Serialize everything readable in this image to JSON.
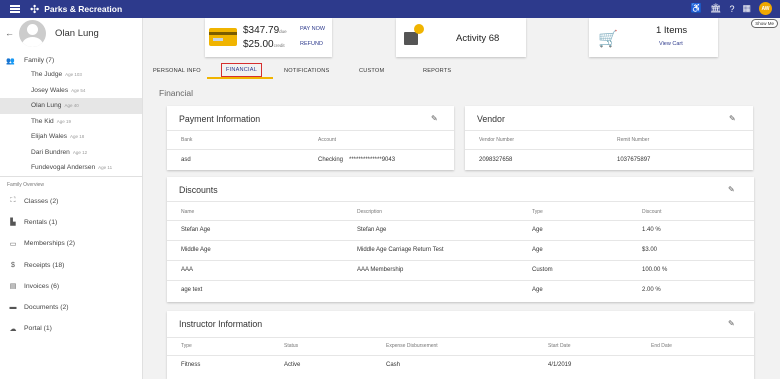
{
  "app": {
    "title": "Parks & Recreation",
    "user_initials": "AW",
    "show_me": "Show Me"
  },
  "icons": {
    "menu": "menu-icon",
    "logo": "logo-icon",
    "accessibility": "accessibility-icon",
    "bank": "bank-icon",
    "help": "help-icon",
    "apps": "apps-grid-icon"
  },
  "sidebar": {
    "person_name": "Olan Lung",
    "family_label": "Family (7)",
    "members": [
      {
        "name": "The Judge",
        "age": "Age 103"
      },
      {
        "name": "Josey Wales",
        "age": "Age 54"
      },
      {
        "name": "Olan Lung",
        "age": "Age 40"
      },
      {
        "name": "The Kid",
        "age": "Age 19"
      },
      {
        "name": "Elijah Wales",
        "age": "Age 18"
      },
      {
        "name": "Dari Bundren",
        "age": "Age 12"
      },
      {
        "name": "Fundevogal Andersen",
        "age": "Age 11"
      }
    ],
    "overview_label": "Family Overview",
    "nav": [
      {
        "label": "Classes (2)",
        "icon": "classes-icon"
      },
      {
        "label": "Rentals (1)",
        "icon": "rentals-icon"
      },
      {
        "label": "Memberships (2)",
        "icon": "memberships-icon"
      },
      {
        "label": "Receipts (18)",
        "icon": "dollar-icon"
      },
      {
        "label": "Invoices (6)",
        "icon": "invoice-icon"
      },
      {
        "label": "Documents (2)",
        "icon": "folder-icon"
      },
      {
        "label": "Portal (1)",
        "icon": "cloud-icon"
      }
    ]
  },
  "summary": {
    "balance": "$347.79",
    "balance_label": "due",
    "credit": "$25.00",
    "credit_label": "credit",
    "pay_now": "PAY NOW",
    "refund": "REFUND",
    "activity": "Activity 68",
    "items": "1 Items",
    "view_cart": "View Cart"
  },
  "tabs": [
    "PERSONAL INFO",
    "FINANCIAL",
    "NOTIFICATIONS",
    "CUSTOM",
    "REPORTS"
  ],
  "section_title": "Financial",
  "payment": {
    "title": "Payment Information",
    "headers": [
      "Bank",
      "Account"
    ],
    "row": [
      "asd",
      "Checking",
      "**************9043"
    ]
  },
  "vendor": {
    "title": "Vendor",
    "headers": [
      "Vendor Number",
      "Remit Number"
    ],
    "row": [
      "2098327658",
      "1037675897"
    ]
  },
  "discounts": {
    "title": "Discounts",
    "headers": [
      "Name",
      "Description",
      "Type",
      "Discount"
    ],
    "rows": [
      [
        "Stefan Age",
        "Stefan Age",
        "Age",
        "1.40 %"
      ],
      [
        "Middle Age",
        "Middle Age Carriage Return Test",
        "Age",
        "$3.00"
      ],
      [
        "AAA",
        "AAA Membership",
        "Custom",
        "100.00 %"
      ],
      [
        "age text",
        "",
        "Age",
        "2.00 %"
      ]
    ]
  },
  "instructor": {
    "title": "Instructor Information",
    "headers": [
      "Type",
      "Status",
      "Expense Disbursement",
      "Start Date",
      "End Date"
    ],
    "row": [
      "Fitness",
      "Active",
      "Cash",
      "4/1/2019",
      ""
    ]
  }
}
